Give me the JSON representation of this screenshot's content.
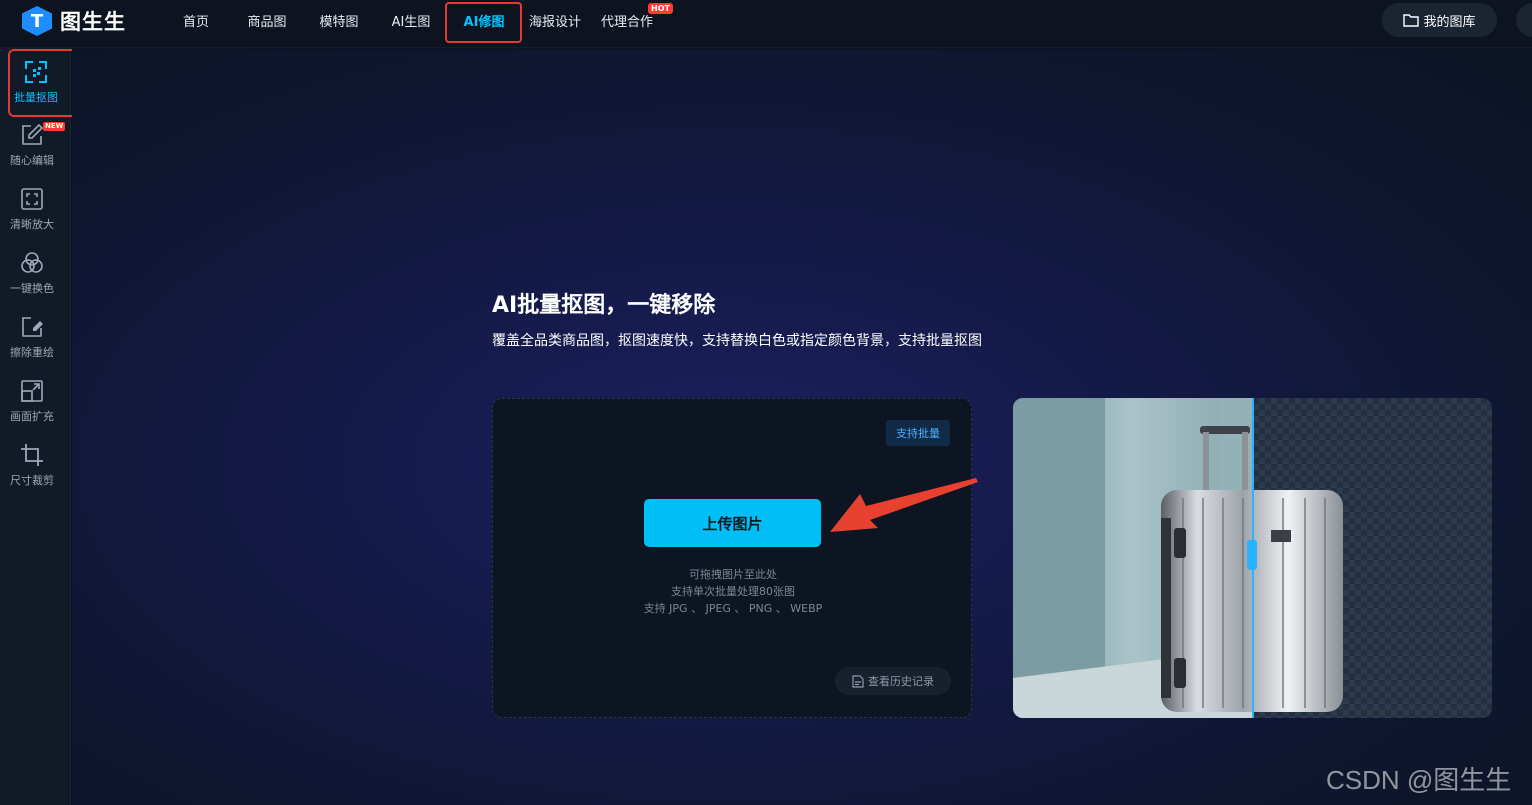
{
  "app": {
    "logo_text": "图生生"
  },
  "nav": {
    "items": [
      {
        "label": "首页"
      },
      {
        "label": "商品图"
      },
      {
        "label": "模特图"
      },
      {
        "label": "AI生图"
      },
      {
        "label": "AI修图"
      },
      {
        "label": "海报设计"
      },
      {
        "label": "代理合作"
      }
    ],
    "active": "AI修图",
    "hot_badge": "HOT",
    "gallery_label": "我的图库"
  },
  "sidebar": {
    "items": [
      {
        "label": "批量抠图",
        "icon": "batch-cutout-icon"
      },
      {
        "label": "随心编辑",
        "icon": "edit-icon"
      },
      {
        "label": "清晰放大",
        "icon": "enlarge-icon"
      },
      {
        "label": "一键换色",
        "icon": "color-change-icon"
      },
      {
        "label": "擦除重绘",
        "icon": "erase-icon"
      },
      {
        "label": "画面扩充",
        "icon": "expand-icon"
      },
      {
        "label": "尺寸裁剪",
        "icon": "crop-icon"
      }
    ],
    "new_badge": "NEW",
    "active": "批量抠图"
  },
  "main": {
    "title": "AI批量抠图，一键移除",
    "subtitle": "覆盖全品类商品图，抠图速度快，支持替换白色或指定颜色背景，支持批量抠图",
    "upload": {
      "batch_tag": "支持批量",
      "button_label": "上传图片",
      "hint_drag": "可拖拽图片至此处",
      "hint_limit": "支持单次批量处理80张图",
      "hint_formats": "支持 JPG 、 JPEG 、 PNG 、 WEBP",
      "history_label": "查看历史记录"
    }
  },
  "watermark": "CSDN @图生生",
  "colors": {
    "accent": "#00bff7",
    "highlight": "#e53935",
    "badge": "#ff3b30"
  }
}
